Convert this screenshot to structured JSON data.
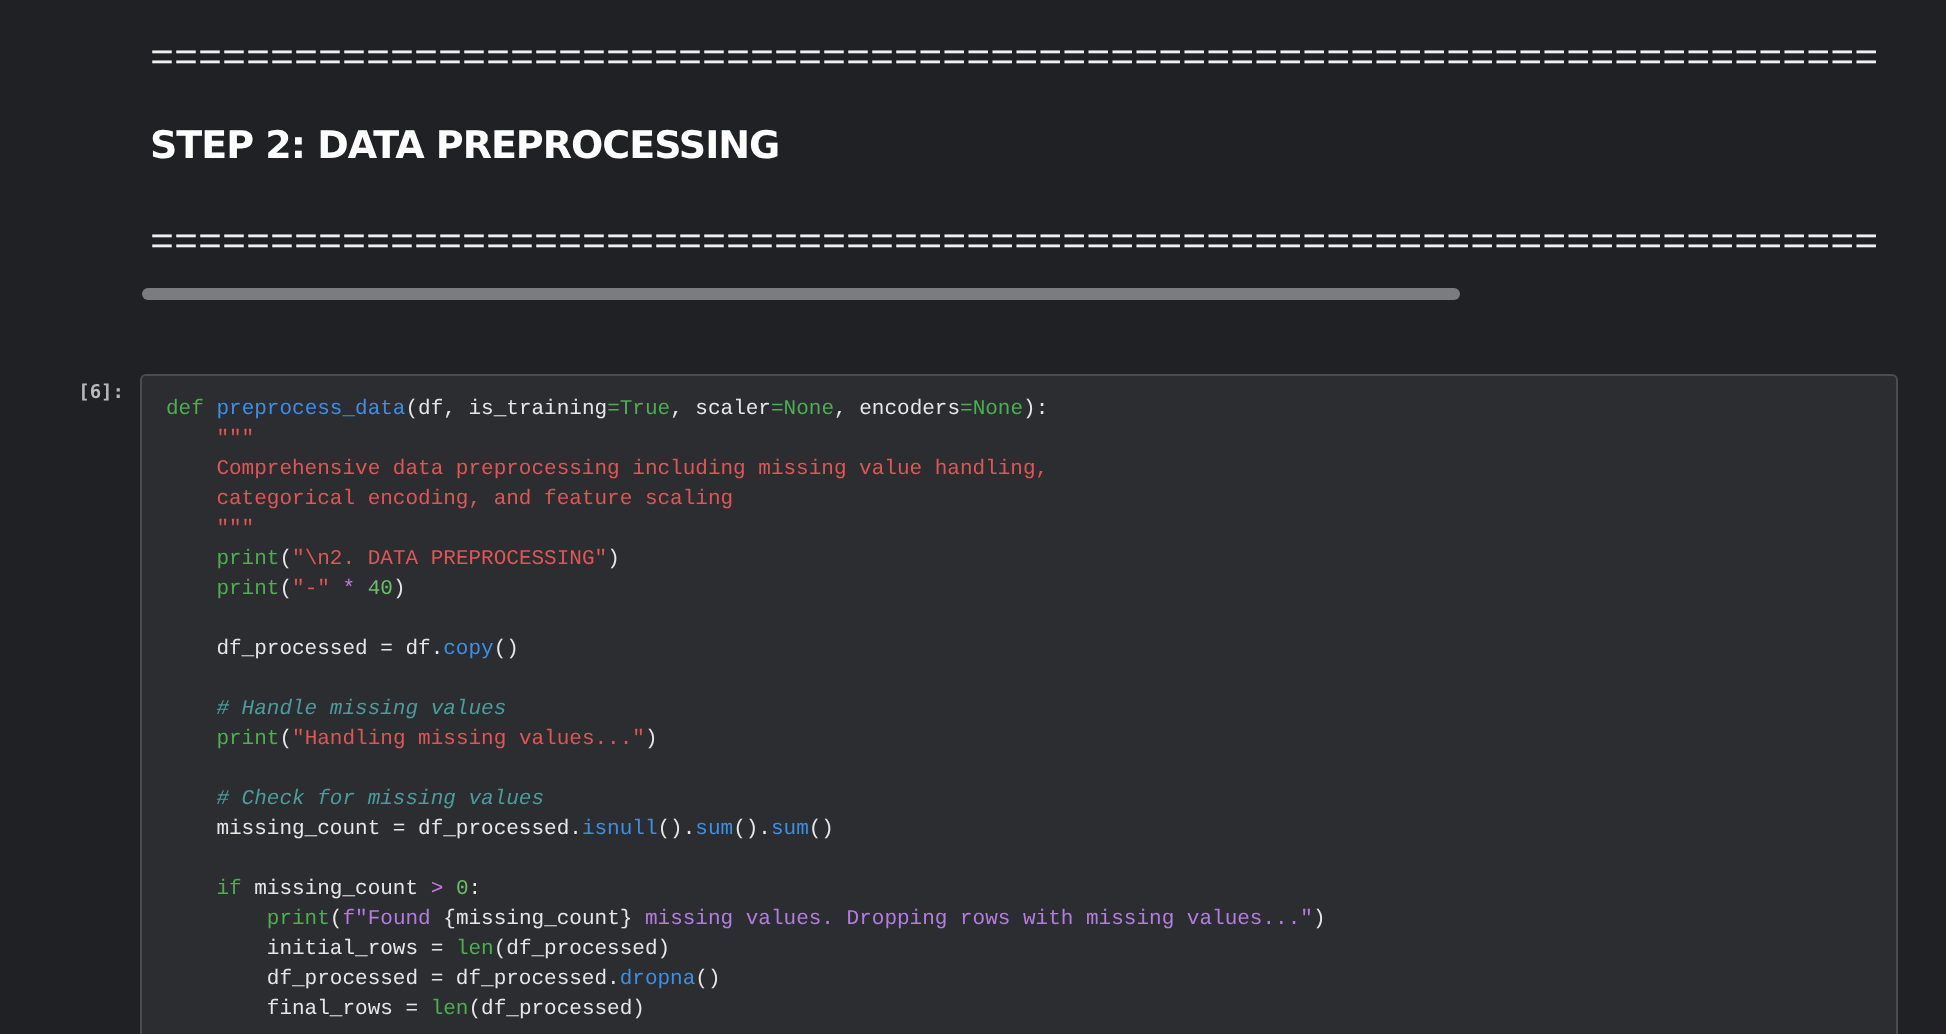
{
  "markdown_cell": {
    "rule_top": "========================================================================",
    "heading": "STEP 2: DATA PREPROCESSING",
    "rule_bottom": "========================================================================"
  },
  "code_cell": {
    "execution_count": "[6]:",
    "lines": [
      {
        "kind": "code",
        "tokens": [
          {
            "kind": "keyword",
            "text": "def "
          },
          {
            "kind": "function",
            "text": "preprocess_data"
          },
          {
            "kind": "plain",
            "text": "(df, is_training"
          },
          {
            "kind": "keyword",
            "text": "=True"
          },
          {
            "kind": "plain",
            "text": ", scaler"
          },
          {
            "kind": "keyword",
            "text": "=None"
          },
          {
            "kind": "plain",
            "text": ", encoders"
          },
          {
            "kind": "keyword",
            "text": "=None"
          },
          {
            "kind": "plain",
            "text": "):"
          }
        ]
      },
      {
        "kind": "code",
        "tokens": [
          {
            "kind": "string",
            "text": "    \"\"\""
          }
        ]
      },
      {
        "kind": "code",
        "tokens": [
          {
            "kind": "string",
            "text": "    Comprehensive data preprocessing including missing value handling,"
          }
        ]
      },
      {
        "kind": "code",
        "tokens": [
          {
            "kind": "string",
            "text": "    categorical encoding, and feature scaling"
          }
        ]
      },
      {
        "kind": "code",
        "tokens": [
          {
            "kind": "string",
            "text": "    \"\"\""
          }
        ]
      },
      {
        "kind": "code",
        "tokens": [
          {
            "kind": "builtin",
            "text": "    print"
          },
          {
            "kind": "plain",
            "text": "("
          },
          {
            "kind": "string",
            "text": "\"\\n2. DATA PREPROCESSING\""
          },
          {
            "kind": "plain",
            "text": ")"
          }
        ]
      },
      {
        "kind": "code",
        "tokens": [
          {
            "kind": "builtin",
            "text": "    print"
          },
          {
            "kind": "plain",
            "text": "("
          },
          {
            "kind": "string",
            "text": "\"-\""
          },
          {
            "kind": "operator",
            "text": " * "
          },
          {
            "kind": "number",
            "text": "40"
          },
          {
            "kind": "plain",
            "text": ")"
          }
        ]
      },
      {
        "kind": "blank"
      },
      {
        "kind": "code",
        "tokens": [
          {
            "kind": "plain",
            "text": "    df_processed = df."
          },
          {
            "kind": "function",
            "text": "copy"
          },
          {
            "kind": "plain",
            "text": "()"
          }
        ]
      },
      {
        "kind": "blank"
      },
      {
        "kind": "code",
        "tokens": [
          {
            "kind": "comment",
            "text": "    # Handle missing values"
          }
        ]
      },
      {
        "kind": "code",
        "tokens": [
          {
            "kind": "builtin",
            "text": "    print"
          },
          {
            "kind": "plain",
            "text": "("
          },
          {
            "kind": "string",
            "text": "\"Handling missing values...\""
          },
          {
            "kind": "plain",
            "text": ")"
          }
        ]
      },
      {
        "kind": "blank"
      },
      {
        "kind": "code",
        "tokens": [
          {
            "kind": "comment",
            "text": "    # Check for missing values"
          }
        ]
      },
      {
        "kind": "code",
        "tokens": [
          {
            "kind": "plain",
            "text": "    missing_count = df_processed."
          },
          {
            "kind": "function",
            "text": "isnull"
          },
          {
            "kind": "plain",
            "text": "()."
          },
          {
            "kind": "function",
            "text": "sum"
          },
          {
            "kind": "plain",
            "text": "()."
          },
          {
            "kind": "function",
            "text": "sum"
          },
          {
            "kind": "plain",
            "text": "()"
          }
        ]
      },
      {
        "kind": "blank"
      },
      {
        "kind": "code",
        "tokens": [
          {
            "kind": "keyword",
            "text": "    if "
          },
          {
            "kind": "plain",
            "text": "missing_count "
          },
          {
            "kind": "operator",
            "text": ">"
          },
          {
            "kind": "number",
            "text": " 0"
          },
          {
            "kind": "plain",
            "text": ":"
          }
        ]
      },
      {
        "kind": "code",
        "tokens": [
          {
            "kind": "builtin",
            "text": "        print"
          },
          {
            "kind": "plain",
            "text": "("
          },
          {
            "kind": "fstring",
            "text": "f\"Found "
          },
          {
            "kind": "plain",
            "text": "{missing_count}"
          },
          {
            "kind": "fstring",
            "text": " missing values. Dropping rows with missing values...\""
          },
          {
            "kind": "plain",
            "text": ")"
          }
        ]
      },
      {
        "kind": "code",
        "tokens": [
          {
            "kind": "plain",
            "text": "        initial_rows = "
          },
          {
            "kind": "builtin",
            "text": "len"
          },
          {
            "kind": "plain",
            "text": "(df_processed)"
          }
        ]
      },
      {
        "kind": "code",
        "tokens": [
          {
            "kind": "plain",
            "text": "        df_processed = df_processed."
          },
          {
            "kind": "function",
            "text": "dropna"
          },
          {
            "kind": "plain",
            "text": "()"
          }
        ]
      },
      {
        "kind": "code",
        "tokens": [
          {
            "kind": "plain",
            "text": "        final_rows = "
          },
          {
            "kind": "builtin",
            "text": "len"
          },
          {
            "kind": "plain",
            "text": "(df_processed)"
          }
        ]
      }
    ]
  }
}
